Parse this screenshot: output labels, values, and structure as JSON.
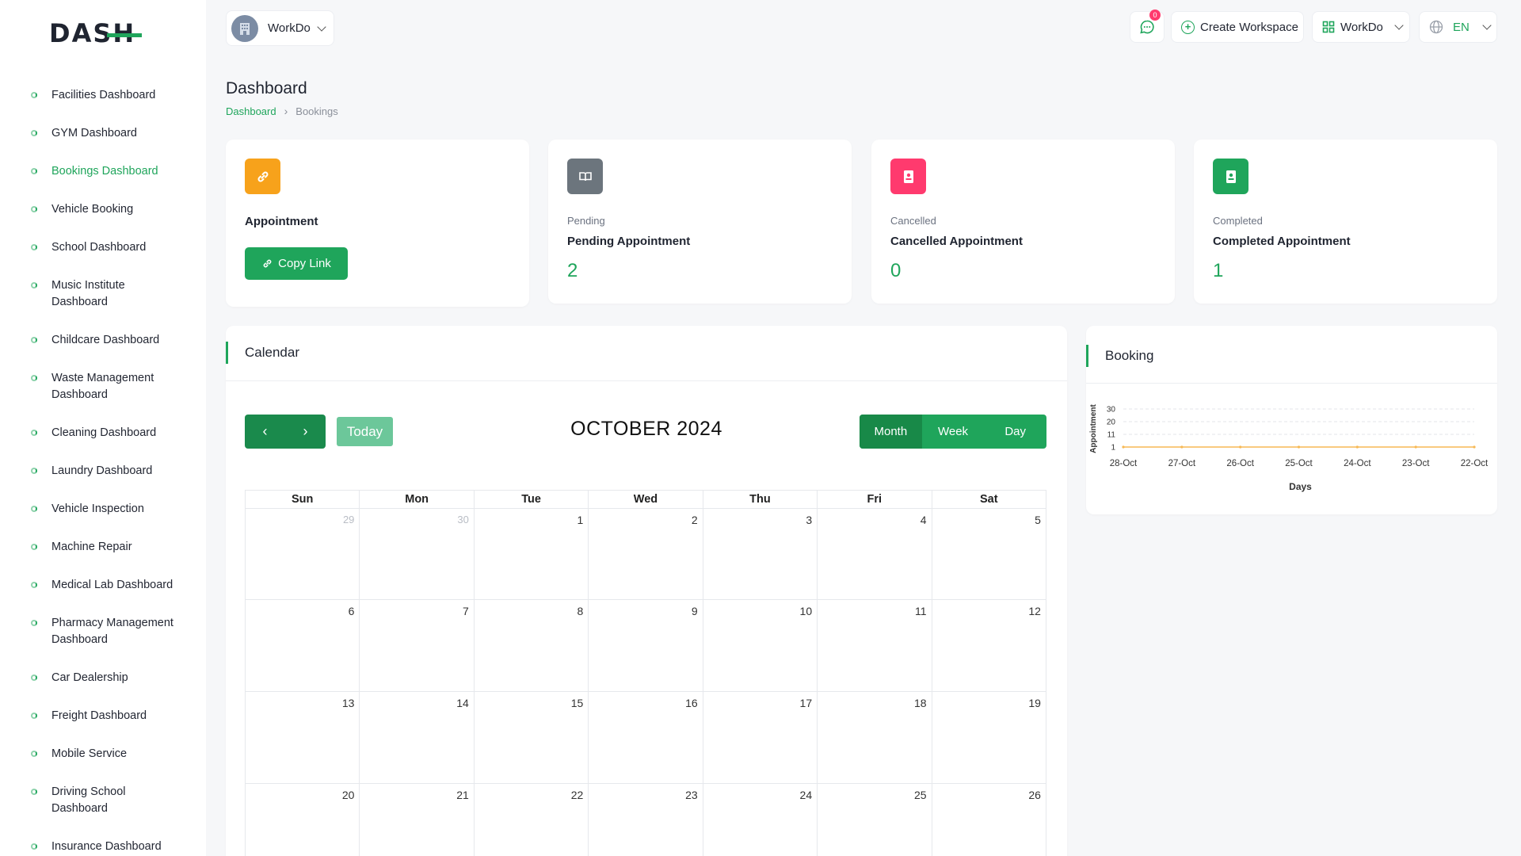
{
  "brand": {
    "logo_text": "DASH"
  },
  "sidebar": {
    "items": [
      {
        "label": "Facilities Dashboard",
        "active": false
      },
      {
        "label": "GYM Dashboard",
        "active": false
      },
      {
        "label": "Bookings Dashboard",
        "active": true
      },
      {
        "label": "Vehicle Booking",
        "active": false
      },
      {
        "label": "School Dashboard",
        "active": false
      },
      {
        "label": "Music Institute Dashboard",
        "active": false
      },
      {
        "label": "Childcare Dashboard",
        "active": false
      },
      {
        "label": "Waste Management Dashboard",
        "active": false
      },
      {
        "label": "Cleaning Dashboard",
        "active": false
      },
      {
        "label": "Laundry Dashboard",
        "active": false
      },
      {
        "label": "Vehicle Inspection",
        "active": false
      },
      {
        "label": "Machine Repair",
        "active": false
      },
      {
        "label": "Medical Lab Dashboard",
        "active": false
      },
      {
        "label": "Pharmacy Management Dashboard",
        "active": false
      },
      {
        "label": "Car Dealership",
        "active": false
      },
      {
        "label": "Freight Dashboard",
        "active": false
      },
      {
        "label": "Mobile Service",
        "active": false
      },
      {
        "label": "Driving School Dashboard",
        "active": false
      },
      {
        "label": "Insurance Dashboard",
        "active": false
      }
    ]
  },
  "header": {
    "workspace": "WorkDo",
    "notification_count": "0",
    "create_workspace": "Create Workspace",
    "workspace_menu": "WorkDo",
    "language": "EN"
  },
  "page": {
    "title": "Dashboard",
    "breadcrumb": [
      "Dashboard",
      "Bookings"
    ]
  },
  "stats": {
    "appointment": {
      "title": "Appointment",
      "button": "Copy Link"
    },
    "pending": {
      "sub": "Pending",
      "title": "Pending Appointment",
      "value": "2"
    },
    "cancelled": {
      "sub": "Cancelled",
      "title": "Cancelled Appointment",
      "value": "0"
    },
    "completed": {
      "sub": "Completed",
      "title": "Completed Appointment",
      "value": "1"
    }
  },
  "colors": {
    "accent": "#1fa55b",
    "appointment_icon": "#f7a21b",
    "pending_icon": "#6c757d",
    "cancelled_icon": "#ff3a6e",
    "completed_icon": "#1fa55b"
  },
  "calendar": {
    "section_title": "Calendar",
    "month_title": "OCTOBER 2024",
    "today_label": "Today",
    "views": [
      "Month",
      "Week",
      "Day"
    ],
    "active_view": "Month",
    "weekdays": [
      "Sun",
      "Mon",
      "Tue",
      "Wed",
      "Thu",
      "Fri",
      "Sat"
    ],
    "weeks": [
      [
        {
          "d": "29",
          "o": true
        },
        {
          "d": "30",
          "o": true
        },
        {
          "d": "1"
        },
        {
          "d": "2"
        },
        {
          "d": "3"
        },
        {
          "d": "4"
        },
        {
          "d": "5"
        }
      ],
      [
        {
          "d": "6"
        },
        {
          "d": "7"
        },
        {
          "d": "8"
        },
        {
          "d": "9"
        },
        {
          "d": "10"
        },
        {
          "d": "11"
        },
        {
          "d": "12"
        }
      ],
      [
        {
          "d": "13"
        },
        {
          "d": "14"
        },
        {
          "d": "15"
        },
        {
          "d": "16"
        },
        {
          "d": "17"
        },
        {
          "d": "18"
        },
        {
          "d": "19"
        }
      ],
      [
        {
          "d": "20"
        },
        {
          "d": "21"
        },
        {
          "d": "22"
        },
        {
          "d": "23"
        },
        {
          "d": "24"
        },
        {
          "d": "25"
        },
        {
          "d": "26"
        }
      ]
    ]
  },
  "booking": {
    "section_title": "Booking"
  },
  "chart_data": {
    "type": "line",
    "title": "",
    "xlabel": "Days",
    "ylabel": "Appointment",
    "categories": [
      "28-Oct",
      "27-Oct",
      "26-Oct",
      "25-Oct",
      "24-Oct",
      "23-Oct",
      "22-Oct"
    ],
    "y_ticks": [
      "30",
      "20",
      "11",
      "1"
    ],
    "series": [
      {
        "values": [
          0,
          0,
          0,
          0,
          0,
          0,
          0
        ],
        "color": "#f7b955"
      }
    ],
    "grid": true
  }
}
